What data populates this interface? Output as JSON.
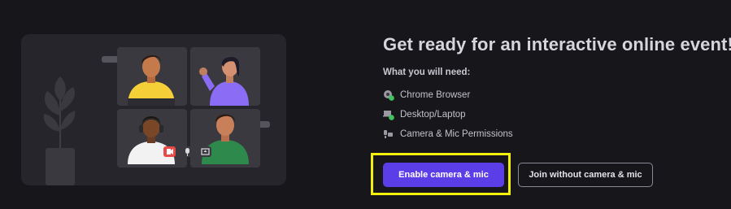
{
  "page": {
    "title": "Get ready for an interactive online event!",
    "subtitle": "What you will need:"
  },
  "requirements": [
    {
      "label": "Chrome Browser",
      "icon": "chrome-icon",
      "status": "ready"
    },
    {
      "label": "Desktop/Laptop",
      "icon": "laptop-icon",
      "status": "ready"
    },
    {
      "label": "Camera & Mic Permissions",
      "icon": "camera-mic-icon",
      "status": "pending"
    }
  ],
  "actions": {
    "enable_label": "Enable camera & mic",
    "join_without_label": "Join without camera & mic"
  },
  "colors": {
    "background": "#17161b",
    "accent": "#5c3ee8",
    "status_ok": "#3ec45c",
    "highlight": "#f2f00c"
  }
}
